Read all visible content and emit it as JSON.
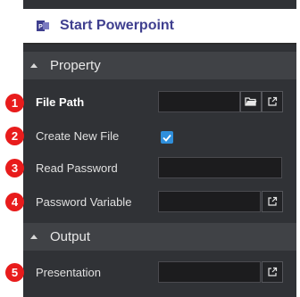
{
  "activity": {
    "title": "Start Powerpoint",
    "icon": "powerpoint-icon"
  },
  "sections": {
    "property": "Property",
    "output": "Output"
  },
  "markers": [
    "1",
    "2",
    "3",
    "4",
    "5"
  ],
  "fields": {
    "file_path": {
      "label": "File Path",
      "value": ""
    },
    "create_new_file": {
      "label": "Create New File",
      "checked": true
    },
    "read_password": {
      "label": "Read Password",
      "value": ""
    },
    "password_variable": {
      "label": "Password Variable",
      "value": ""
    },
    "presentation": {
      "label": "Presentation",
      "value": ""
    }
  },
  "colors": {
    "accent": "#3f3f8f",
    "marker": "#e81c1c",
    "checkbox": "#2f8fdc",
    "panel": "#303236"
  }
}
